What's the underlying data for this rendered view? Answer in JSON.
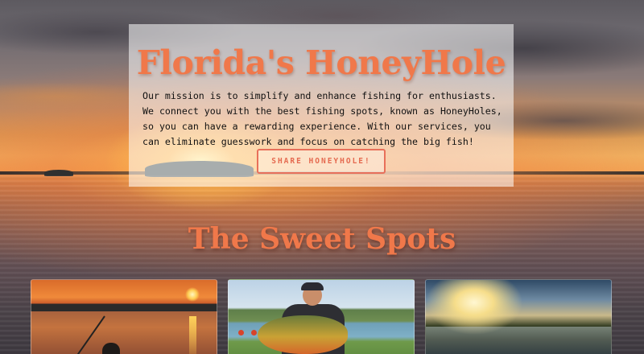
{
  "hero": {
    "title": "Florida's HoneyHole",
    "mission_text": "Our mission is to simplify and enhance fishing for enthusiasts. We connect you with the best fishing spots, known as HoneyHoles, so you can have a rewarding experience. With our services, you can eliminate guesswork and focus on catching the big fish!",
    "share_button_label": "SHARE HONEYHOLE!"
  },
  "sweet_spots": {
    "title": "The Sweet Spots",
    "cards": [
      {
        "image": "sunset-fishing-photo"
      },
      {
        "image": "angler-with-peacock-bass-photo"
      },
      {
        "image": "misty-lake-sunrise-photo"
      }
    ]
  },
  "colors": {
    "accent": "#f0784a",
    "button_border": "#e8705a"
  }
}
